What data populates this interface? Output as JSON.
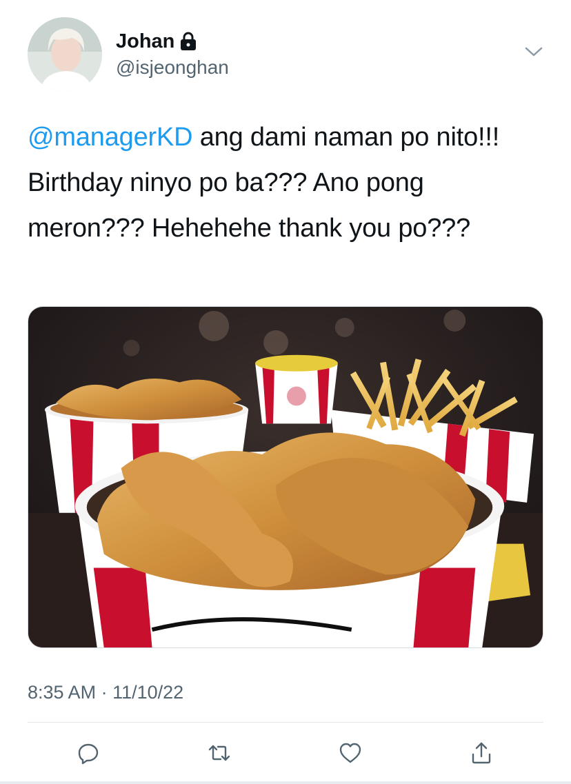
{
  "user": {
    "display_name": "Johan",
    "handle": "@isjeonghan",
    "protected_icon": "lock-icon",
    "avatar": "avatar-photo"
  },
  "tweet": {
    "mention": "@managerKD",
    "text_rest": " ang dami naman po nito!!! Birthday ninyo po ba??? Ano pong meron??? Hehehehe thank you po???",
    "media": "photo-fried-chicken-bucket",
    "time": "8:35 AM",
    "separator": " · ",
    "date": "11/10/22"
  },
  "actions": {
    "reply_icon": "reply-icon",
    "retweet_icon": "retweet-icon",
    "like_icon": "heart-icon",
    "share_icon": "share-icon"
  },
  "colors": {
    "accent": "#1d9bf0",
    "secondary_text": "#536471",
    "primary_text": "#0f1419"
  }
}
